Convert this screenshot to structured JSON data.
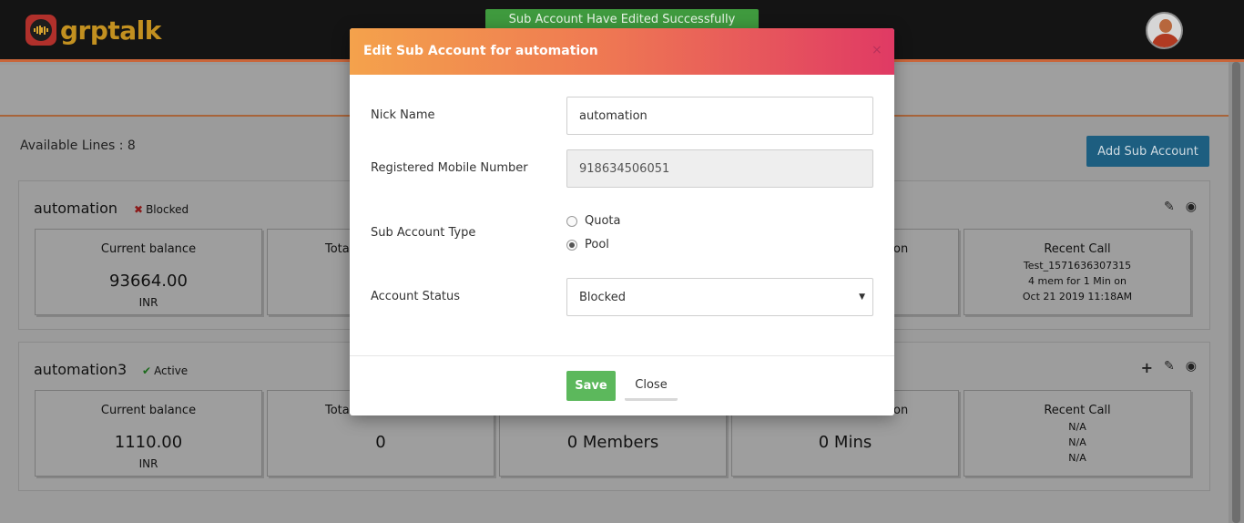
{
  "brand": {
    "name": "grptalk"
  },
  "toast": {
    "message": "Sub Account Have Edited Successfully"
  },
  "page": {
    "available_lines": "Available Lines : 8",
    "add_button": "Add Sub Account"
  },
  "accounts": [
    {
      "name": "automation",
      "status": "Blocked",
      "status_mark": "✖",
      "current_balance_label": "Current balance",
      "current_balance": "93664.00",
      "currency": "INR",
      "total_label_partial": "Tota",
      "duration_label_partial": "on",
      "recent_call_label": "Recent Call",
      "recent_call_lines": [
        "Test_1571636307315",
        "4 mem for 1 Min on",
        "Oct 21 2019 11:18AM"
      ]
    },
    {
      "name": "automation3",
      "status": "Active",
      "status_mark": "✔",
      "current_balance_label": "Current balance",
      "current_balance": "1110.00",
      "currency": "INR",
      "total_label_partial": "Tota",
      "total_value": "0",
      "members_value": "0 Members",
      "duration_label_partial": "on",
      "duration_value": "0 Mins",
      "recent_call_label": "Recent Call",
      "recent_call_lines": [
        "N/A",
        "N/A",
        "N/A"
      ]
    }
  ],
  "modal": {
    "title": "Edit Sub Account for automation",
    "close_icon": "×",
    "nick_name_label": "Nick Name",
    "nick_name_value": "automation",
    "mobile_label": "Registered Mobile Number",
    "mobile_value": "918634506051",
    "type_label": "Sub Account Type",
    "type_options": [
      "Quota",
      "Pool"
    ],
    "type_selected": "Pool",
    "status_label": "Account Status",
    "status_value": "Blocked",
    "save_label": "Save",
    "close_label": "Close"
  },
  "colors": {
    "toast_bg": "#3f9a3e",
    "header_gradient_start": "#f4a24c",
    "header_gradient_end": "#e03a64",
    "save_bg": "#5cb85c",
    "add_btn_bg": "#1d5e80",
    "brand_gold": "#c29020"
  },
  "icons": [
    "edit-pencil-icon",
    "view-eye-icon",
    "add-plus-icon",
    "user-avatar-icon"
  ]
}
